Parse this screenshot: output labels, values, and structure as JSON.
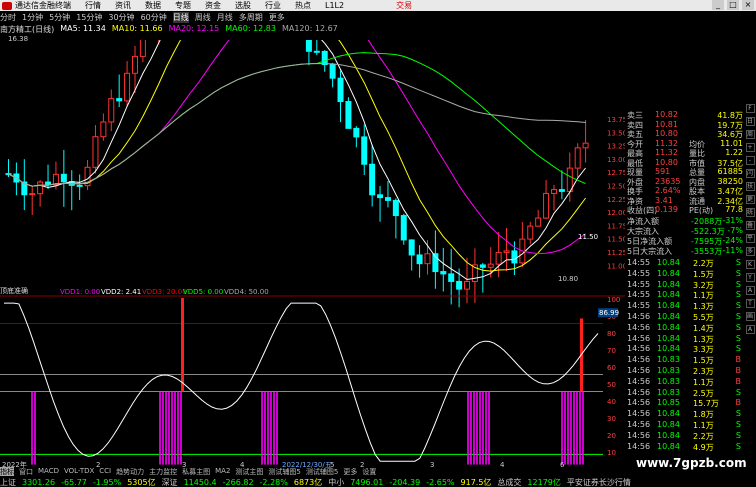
{
  "app": {
    "title": "通达信金融终端",
    "trade_button": "交易"
  },
  "menu": [
    "行情",
    "资讯",
    "数据",
    "专题",
    "资金",
    "选股",
    "行业",
    "热点",
    "L1L2"
  ],
  "periods": [
    {
      "label": "分时",
      "active": false
    },
    {
      "label": "1分钟",
      "active": false
    },
    {
      "label": "5分钟",
      "active": false
    },
    {
      "label": "15分钟",
      "active": false
    },
    {
      "label": "30分钟",
      "active": false
    },
    {
      "label": "60分钟",
      "active": false
    },
    {
      "label": "日线",
      "active": true
    },
    {
      "label": "周线",
      "active": false
    },
    {
      "label": "月线",
      "active": false
    },
    {
      "label": "多周期",
      "active": false
    },
    {
      "label": "更多",
      "active": false
    }
  ],
  "legend": {
    "stock": "南方精工(日线)",
    "ma5": "MA5: 11.34",
    "ma10": "MA10: 11.66",
    "ma20": "MA20: 12.15",
    "ma60": "MA60: 12.83",
    "ma120": "MA120: 12.67",
    "colors": {
      "stock": "#dddddd",
      "ma5": "#ffffff",
      "ma10": "#ffff00",
      "ma20": "#ff00ff",
      "ma60": "#00ff00",
      "ma120": "#aaaaaa"
    }
  },
  "high_marker": "16.38",
  "low_marker": "10.80",
  "cross_marker": "11.50",
  "price_axis": [
    "13.75",
    "13.50",
    "13.25",
    "13.00",
    "12.75",
    "12.50",
    "12.25",
    "12.00",
    "11.75",
    "11.50",
    "11.25",
    "11.00"
  ],
  "indicator": {
    "name": "顶底准确",
    "labels": [
      {
        "text": "VDD1: 0.00",
        "color": "#ff00ff"
      },
      {
        "text": "VDD2: 2.41",
        "color": "#ffffff"
      },
      {
        "text": "VDD3: 20.00",
        "color": "#ff0000"
      },
      {
        "text": "VDD5: 0.00",
        "color": "#00ff00"
      },
      {
        "text": "VDD4: 50.00",
        "color": "#aaaaaa"
      }
    ],
    "value_box": "86.99",
    "axis": [
      "100",
      "90",
      "80",
      "70",
      "60",
      "50",
      "40",
      "30",
      "20",
      "10"
    ]
  },
  "date_axis": [
    "2022年",
    "2",
    "3",
    "4",
    "5",
    "2022/12/30/五",
    "2",
    "3",
    "4",
    "6"
  ],
  "quote_panel": {
    "rows": [
      {
        "l": "卖三",
        "v": "10.82",
        "r": "41.8万"
      },
      {
        "l": "卖四",
        "v": "10.81",
        "r": "19.7万"
      },
      {
        "l": "卖五",
        "v": "10.80",
        "r": "34.6万"
      },
      {
        "l": "今开",
        "v": "11.32",
        "r2l": "均价",
        "r": "11.01"
      },
      {
        "l": "最高",
        "v": "11.32",
        "r2l": "量比",
        "r": "1.22"
      },
      {
        "l": "最低",
        "v": "10.80",
        "r2l": "市值",
        "r": "37.5亿"
      },
      {
        "l": "现量",
        "v": "591",
        "r2l": "总量",
        "r": "61885"
      },
      {
        "l": "外盘",
        "v": "23635",
        "r2l": "内盘",
        "r": "38250"
      },
      {
        "l": "换手",
        "v": "2.64%",
        "r2l": "股本",
        "r": "3.47亿"
      },
      {
        "l": "净资",
        "v": "3.41",
        "r2l": "流通",
        "r": "2.34亿"
      },
      {
        "l": "收益(四)",
        "v": "0.139",
        "r2l": "PE(动)",
        "r": "77.8"
      }
    ],
    "flows": [
      {
        "l": "净流入额",
        "v": "-2088万",
        "p": "-31%"
      },
      {
        "l": "大宗流入",
        "v": "-522.3万",
        "p": "-7%"
      },
      {
        "l": "5日净流入额",
        "v": "-7595万",
        "p": "-24%"
      },
      {
        "l": "5日大宗流入",
        "v": "-3553万",
        "p": "-11%"
      }
    ],
    "ticks": [
      {
        "t": "14:55",
        "p": "10.84",
        "v": "2.2",
        "u": "万",
        "s": "S"
      },
      {
        "t": "14:55",
        "p": "10.84",
        "v": "1.5",
        "u": "万",
        "s": "S"
      },
      {
        "t": "14:55",
        "p": "10.84",
        "v": "3.2",
        "u": "万",
        "s": "S"
      },
      {
        "t": "14:55",
        "p": "10.84",
        "v": "1.1",
        "u": "万",
        "s": "S"
      },
      {
        "t": "14:55",
        "p": "10.84",
        "v": "1.3",
        "u": "万",
        "s": "S"
      },
      {
        "t": "14:56",
        "p": "10.84",
        "v": "5.5",
        "u": "万",
        "s": "S"
      },
      {
        "t": "14:56",
        "p": "10.84",
        "v": "1.4",
        "u": "万",
        "s": "S"
      },
      {
        "t": "14:56",
        "p": "10.84",
        "v": "1.3",
        "u": "万",
        "s": "S"
      },
      {
        "t": "14:56",
        "p": "10.84",
        "v": "3.3",
        "u": "万",
        "s": "S"
      },
      {
        "t": "14:56",
        "p": "10.83",
        "v": "1.5",
        "u": "万",
        "s": "B"
      },
      {
        "t": "14:56",
        "p": "10.83",
        "v": "2.3",
        "u": "万",
        "s": "B"
      },
      {
        "t": "14:56",
        "p": "10.83",
        "v": "1.1",
        "u": "万",
        "s": "B"
      },
      {
        "t": "14:56",
        "p": "10.83",
        "v": "2.5",
        "u": "万",
        "s": "S"
      },
      {
        "t": "14:56",
        "p": "10.85",
        "v": "15.7",
        "u": "万",
        "s": "B"
      },
      {
        "t": "14:56",
        "p": "10.84",
        "v": "1.8",
        "u": "万",
        "s": "S"
      },
      {
        "t": "14:56",
        "p": "10.84",
        "v": "1.1",
        "u": "万",
        "s": "S"
      },
      {
        "t": "14:56",
        "p": "10.84",
        "v": "2.2",
        "u": "万",
        "s": "S"
      },
      {
        "t": "14:56",
        "p": "10.84",
        "v": "4.9",
        "u": "万",
        "s": "S"
      }
    ]
  },
  "tabs1": [
    "指标",
    "窗口",
    "MACD",
    "VOL-TDX",
    "CCI",
    "趋势动力",
    "主力监控",
    "私募主图",
    "MA2",
    "测试主图",
    "测试辅图5",
    "测试辅图5",
    "更多",
    "设置"
  ],
  "tabs2": [
    "扩展A",
    "关联报价",
    "资金分布",
    "综合资讯",
    "行业资讯",
    "互动问答",
    "偷得户届科专章"
  ],
  "status": [
    {
      "name": "上证",
      "val": "3301.26",
      "chg": "-65.77",
      "pct": "-1.95%",
      "amt": "5305亿"
    },
    {
      "name": "深证",
      "val": "11450.4",
      "chg": "-266.82",
      "pct": "-2.28%",
      "amt": "6873亿"
    },
    {
      "name": "中小",
      "val": "7496.01",
      "chg": "-204.39",
      "pct": "-2.65%",
      "amt": "917.5亿"
    },
    {
      "name": "总成交",
      "val": "12179亿",
      "chg": "",
      "pct": "",
      "amt": ""
    }
  ],
  "status_tail": "平安证券长沙行情",
  "watermark": "www.7gpzb.com",
  "sidebar_icons": [
    "F",
    "日",
    "周",
    "+",
    "-",
    "闪",
    "扶",
    "更",
    "统",
    "叠",
    "平",
    "多",
    "K",
    "Y",
    "A",
    "T",
    "画",
    "A"
  ]
}
